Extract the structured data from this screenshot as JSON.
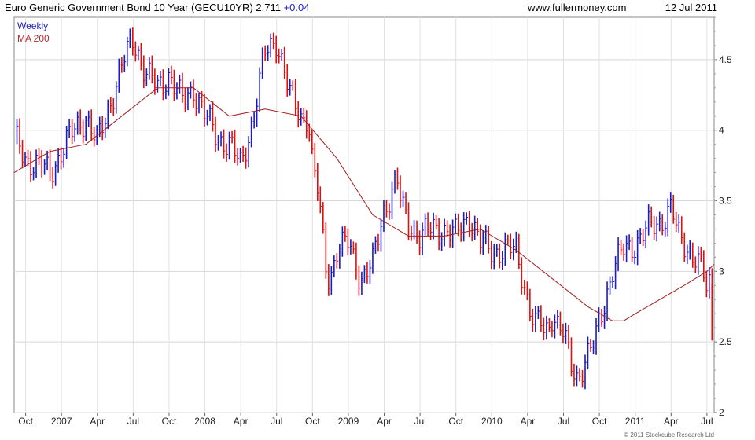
{
  "header": {
    "title": "Euro Generic Government Bond 10 Year (GECU10YR) 2.711",
    "change": "+0.04",
    "site": "www.fullermoney.com",
    "date": "12 Jul 2011"
  },
  "footer": {
    "copyright": "© 2011 Stockcube Research Ltd"
  },
  "chart_data": {
    "type": "line",
    "chart_style": "weekly price bars with moving average",
    "period_label": "Weekly",
    "legend": [
      "Weekly",
      "MA 200"
    ],
    "legend_placement": "top-left",
    "ylim": [
      2.0,
      4.8
    ],
    "y_ticks": [
      2,
      2.5,
      3,
      3.5,
      4,
      4.5
    ],
    "y_tick_labels": [
      "2",
      "2.5",
      "3",
      "3.5",
      "4",
      "4.5"
    ],
    "grid": true,
    "x_tick_labels": [
      "Oct",
      "2007",
      "Apr",
      "Jul",
      "Oct",
      "2008",
      "Apr",
      "Jul",
      "Oct",
      "2009",
      "Apr",
      "Jul",
      "Oct",
      "2010",
      "Apr",
      "Jul",
      "Oct",
      "2011",
      "Apr",
      "Jul"
    ],
    "x_tick_positions": [
      0.08,
      0.33,
      0.58,
      0.83,
      1.08,
      1.33,
      1.58,
      1.83,
      2.08,
      2.33,
      2.58,
      2.83,
      3.08,
      3.33,
      3.58,
      3.83,
      4.08,
      4.33,
      4.58,
      4.83
    ],
    "x_domain": [
      0.0,
      4.88
    ],
    "colors": {
      "up": "#1a1ac8",
      "down": "#e01010",
      "ma": "#a02020"
    },
    "series": [
      {
        "name": "Weekly",
        "x": [
          0.0,
          0.08,
          0.17,
          0.25,
          0.33,
          0.42,
          0.5,
          0.58,
          0.67,
          0.75,
          0.83,
          0.92,
          1.0,
          1.08,
          1.17,
          1.25,
          1.33,
          1.42,
          1.5,
          1.58,
          1.67,
          1.75,
          1.83,
          1.92,
          2.0,
          2.05,
          2.08,
          2.12,
          2.17,
          2.2,
          2.25,
          2.33,
          2.42,
          2.5,
          2.55,
          2.58,
          2.67,
          2.7,
          2.75,
          2.83,
          2.92,
          3.0,
          3.08,
          3.17,
          3.25,
          3.33,
          3.42,
          3.5,
          3.55,
          3.58,
          3.63,
          3.67,
          3.7,
          3.75,
          3.83,
          3.88,
          3.92,
          4.0,
          4.05,
          4.08,
          4.17,
          4.25,
          4.33,
          4.42,
          4.5,
          4.58,
          4.63,
          4.67,
          4.75,
          4.8,
          4.83,
          4.86,
          4.88
        ],
        "close": [
          3.95,
          3.8,
          3.75,
          3.7,
          3.85,
          4.0,
          4.1,
          3.9,
          4.2,
          4.45,
          4.65,
          4.4,
          4.3,
          4.4,
          4.2,
          4.3,
          4.1,
          3.95,
          3.9,
          3.75,
          4.1,
          4.55,
          4.65,
          4.25,
          4.1,
          4.1,
          3.75,
          3.55,
          3.05,
          2.95,
          3.15,
          3.2,
          2.95,
          3.05,
          3.3,
          3.45,
          3.65,
          3.45,
          3.35,
          3.25,
          3.3,
          3.3,
          3.25,
          3.4,
          3.2,
          3.15,
          3.15,
          3.15,
          2.95,
          2.8,
          2.6,
          2.65,
          2.55,
          2.7,
          2.55,
          2.35,
          2.25,
          2.4,
          2.5,
          2.65,
          3.0,
          3.15,
          3.2,
          3.3,
          3.35,
          3.45,
          3.25,
          3.2,
          3.1,
          3.0,
          2.85,
          2.95,
          2.71
        ]
      },
      {
        "name": "MA 200",
        "x": [
          0.0,
          0.25,
          0.5,
          0.75,
          1.0,
          1.25,
          1.5,
          1.75,
          2.0,
          2.25,
          2.5,
          2.75,
          3.0,
          3.25,
          3.5,
          3.75,
          4.0,
          4.17,
          4.25,
          4.33,
          4.5,
          4.67,
          4.75,
          4.83,
          4.88
        ],
        "values": [
          3.7,
          3.85,
          3.9,
          4.1,
          4.3,
          4.3,
          4.1,
          4.15,
          4.1,
          3.8,
          3.4,
          3.25,
          3.25,
          3.3,
          3.15,
          2.95,
          2.75,
          2.65,
          2.65,
          2.7,
          2.8,
          2.9,
          2.95,
          3.0,
          3.05
        ]
      }
    ]
  }
}
